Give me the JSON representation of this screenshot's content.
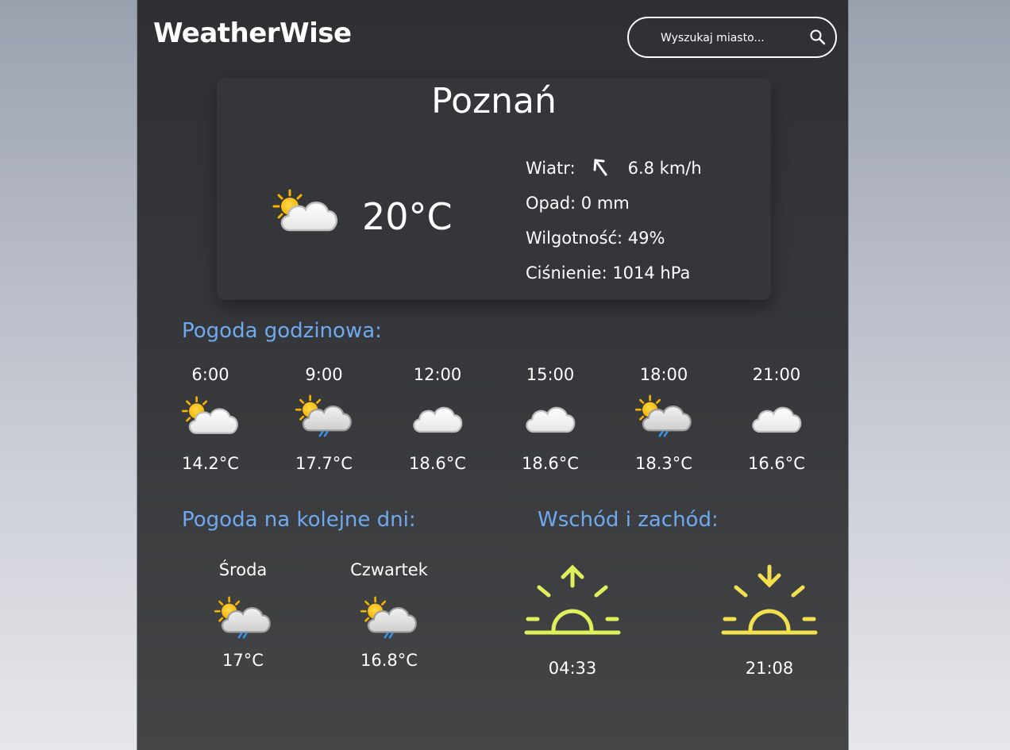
{
  "app": {
    "name": "WeatherWise"
  },
  "search": {
    "placeholder": "Wyszukaj miasto..."
  },
  "current": {
    "city": "Poznań",
    "temp": "20°C",
    "icon": "partly-cloudy-icon",
    "wind_label": "Wiatr:",
    "wind_value": "6.8 km/h",
    "precip": "Opad: 0 mm",
    "humidity": "Wilgotność: 49%",
    "pressure": "Ciśnienie: 1014 hPa"
  },
  "hourly": {
    "title": "Pogoda godzinowa:",
    "items": [
      {
        "time": "6:00",
        "temp": "14.2°C",
        "icon": "partly-cloudy-icon"
      },
      {
        "time": "9:00",
        "temp": "17.7°C",
        "icon": "sun-cloud-rain-icon"
      },
      {
        "time": "12:00",
        "temp": "18.6°C",
        "icon": "cloud-icon"
      },
      {
        "time": "15:00",
        "temp": "18.6°C",
        "icon": "cloud-icon"
      },
      {
        "time": "18:00",
        "temp": "18.3°C",
        "icon": "sun-cloud-rain-icon"
      },
      {
        "time": "21:00",
        "temp": "16.6°C",
        "icon": "cloud-icon"
      }
    ]
  },
  "daily": {
    "title": "Pogoda na kolejne dni:",
    "items": [
      {
        "day": "Środa",
        "temp": "17°C",
        "icon": "sun-cloud-rain-icon"
      },
      {
        "day": "Czwartek",
        "temp": "16.8°C",
        "icon": "sun-cloud-rain-icon"
      }
    ]
  },
  "sun": {
    "title": "Wschód i zachód:",
    "sunrise": "04:33",
    "sunset": "21:08",
    "sunrise_color": "#dff05a",
    "sunset_color": "#f2e04e"
  },
  "colors": {
    "accent": "#6fa9ee",
    "background": "#333438"
  }
}
